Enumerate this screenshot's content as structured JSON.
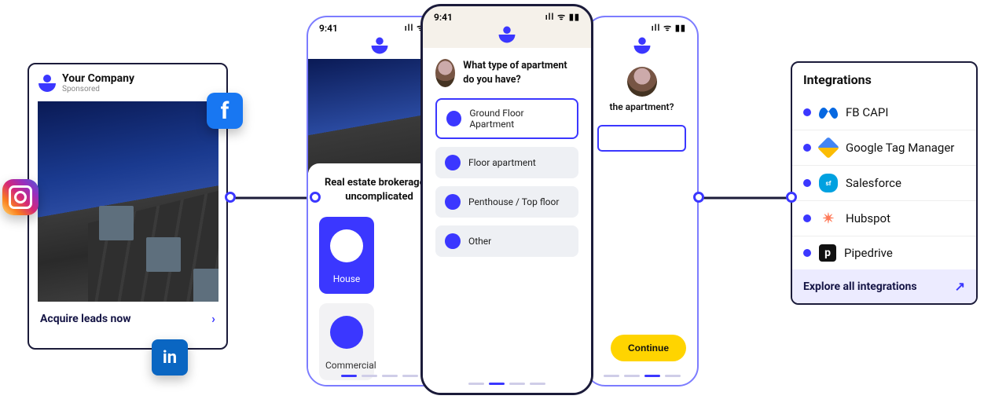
{
  "ad": {
    "company": "Your Company",
    "sponsored": "Sponsored",
    "cta": "Acquire leads now"
  },
  "social": {
    "facebook": "f",
    "linkedin": "in"
  },
  "status": {
    "time": "9:41",
    "icons": "ıll  ᯤ  ▮▮"
  },
  "phone_left": {
    "headline": "Real estate brokerage – uncomplicated",
    "tile_house": "House",
    "tile_commercial": "Commercial"
  },
  "phone_center": {
    "question": "What type of apartment do you have?",
    "options": [
      "Ground Floor Apartment",
      "Floor apartment",
      "Penthouse / Top floor",
      "Other"
    ]
  },
  "phone_right": {
    "question_suffix": "the apartment?",
    "continue": "Continue"
  },
  "integrations": {
    "title": "Integrations",
    "items": [
      "FB CAPI",
      "Google Tag Manager",
      "Salesforce",
      "Hubspot",
      "Pipedrive"
    ],
    "explore": "Explore all integrations"
  }
}
